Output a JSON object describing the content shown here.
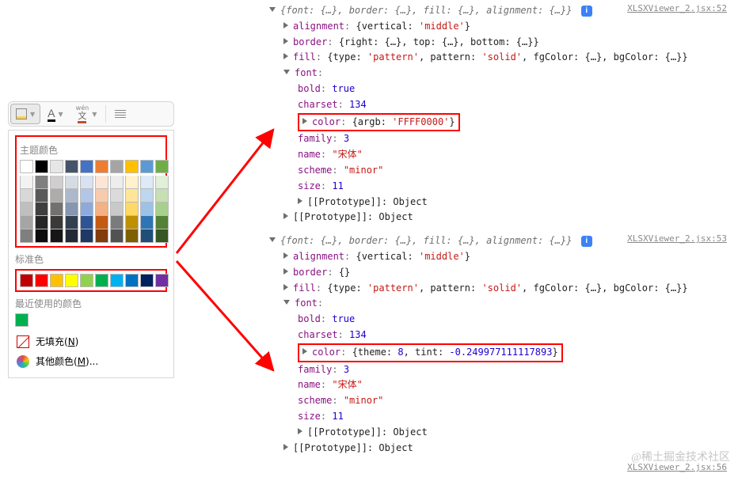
{
  "toolbar": {
    "fill_tool": "fill-color",
    "font_color_glyph": "A",
    "font_color_underline": "#000000",
    "wen_glyph": "文",
    "wen_ruby": "wén",
    "wen_underline": "#c44e2d"
  },
  "picker": {
    "theme_title": "主题颜色",
    "theme_head": [
      "#ffffff",
      "#000000",
      "#e7e6e6",
      "#44546a",
      "#4472c4",
      "#ed7d31",
      "#a5a5a5",
      "#ffc000",
      "#5b9bd5",
      "#70ad47"
    ],
    "theme_shade_map": [
      [
        "#f2f2f2",
        "#7f7f7f",
        "#d0cece",
        "#d6dce4",
        "#d9e2f3",
        "#fbe5d5",
        "#ededed",
        "#fff2cc",
        "#deebf6",
        "#e2efd9"
      ],
      [
        "#d8d8d8",
        "#595959",
        "#aeabab",
        "#adb9ca",
        "#b4c6e7",
        "#f7cbac",
        "#dbdbdb",
        "#fee599",
        "#bdd7ee",
        "#c5e0b3"
      ],
      [
        "#bfbfbf",
        "#3f3f3f",
        "#757070",
        "#8496b0",
        "#8eaadb",
        "#f4b183",
        "#c9c9c9",
        "#ffd965",
        "#9cc3e5",
        "#a8d08d"
      ],
      [
        "#a5a5a5",
        "#262626",
        "#3a3838",
        "#323f4f",
        "#2f5496",
        "#c55a11",
        "#7b7b7b",
        "#bf9000",
        "#2e75b5",
        "#538135"
      ],
      [
        "#7f7f7f",
        "#0c0c0c",
        "#171616",
        "#222a35",
        "#1f3864",
        "#833c0b",
        "#525252",
        "#7f6000",
        "#1e4e79",
        "#375623"
      ]
    ],
    "standard_title": "标准色",
    "standard": [
      "#c00000",
      "#ff0000",
      "#ffc000",
      "#ffff00",
      "#92d050",
      "#00b050",
      "#00b0f0",
      "#0070c0",
      "#002060",
      "#7030a0"
    ],
    "recent_title": "最近使用的颜色",
    "recent": [
      "#00b050"
    ],
    "no_fill_label": "无填充(",
    "no_fill_key": "N",
    "no_fill_tail": ")",
    "more_label": "其他颜色(",
    "more_key": "M",
    "more_tail": ")..."
  },
  "console": {
    "sourceA": "XLSXViewer_2.jsx:52",
    "sourceB": "XLSXViewer_2.jsx:53",
    "sourceC": "XLSXViewer_2.jsx:56",
    "summary": "{font: {…}, border: {…}, fill: {…}, alignment: {…}}",
    "a": {
      "alignment_val": "'middle'",
      "border_val": "{right: {…}, top: {…}, bottom: {…}}",
      "fill_type": "'pattern'",
      "fill_pattern": "'solid'",
      "fill_rest": "fgColor: {…}, bgColor: {…}}",
      "bold": "true",
      "charset": "134",
      "color_raw": "{argb: 'FFFF0000'}",
      "color_val": "'FFFF0000'",
      "family": "3",
      "name": "\"宋体\"",
      "scheme": "\"minor\"",
      "size": "11",
      "proto": "[[Prototype]]: Object"
    },
    "b": {
      "border_val": "{}",
      "color_theme": "8",
      "color_tint": "-0.249977111117893"
    }
  },
  "watermark": "@稀土掘金技术社区"
}
